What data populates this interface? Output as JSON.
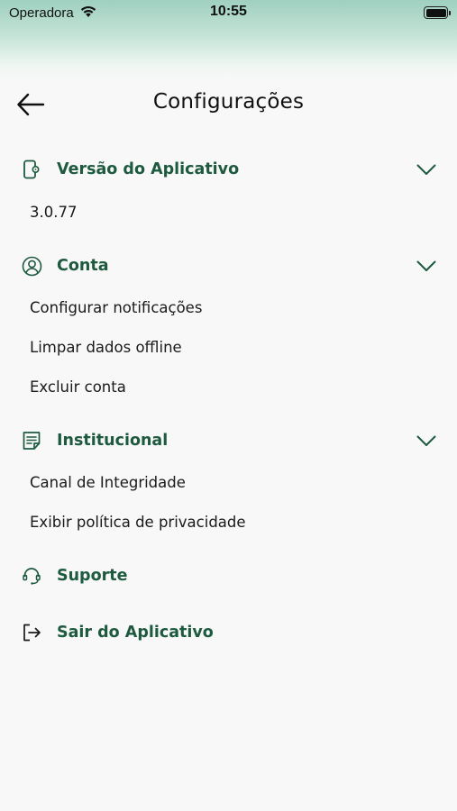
{
  "status_bar": {
    "carrier": "Operadora",
    "time": "10:55"
  },
  "header": {
    "title": "Configurações"
  },
  "sections": {
    "version": {
      "title": "Versão do Aplicativo",
      "value": "3.0.77"
    },
    "account": {
      "title": "Conta",
      "items": [
        "Configurar notificações",
        "Limpar dados offline",
        "Excluir conta"
      ]
    },
    "institutional": {
      "title": "Institucional",
      "items": [
        "Canal de Integridade",
        "Exibir política de privacidade"
      ]
    },
    "support": {
      "title": "Suporte"
    },
    "logout": {
      "title": "Sair do Aplicativo"
    }
  },
  "colors": {
    "accent": "#1e5a3f",
    "background": "#f8f8f8",
    "header_gradient": "#9fd0bf"
  },
  "icons": {
    "back": "arrow-left-icon",
    "version": "phone-gear-icon",
    "account": "user-circle-icon",
    "institutional": "document-icon",
    "support": "headset-icon",
    "logout": "logout-icon",
    "expand": "chevron-down-icon"
  }
}
